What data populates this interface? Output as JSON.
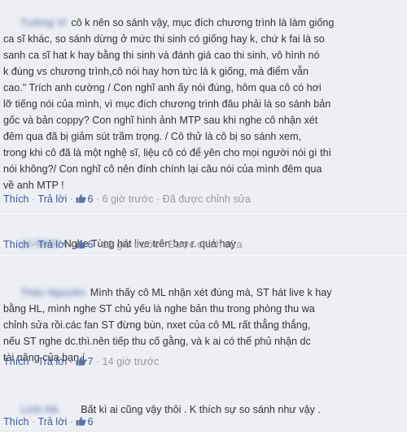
{
  "comments": [
    {
      "author": "Tường Vi",
      "text": "cô k nên so sánh vậy, mục đích chương trình là làm giống\nca sĩ khác, so sánh dừng ở mức thi sinh có giống hay k, chứ k fai là so\nsanh ca sĩ hat k hay bằng thi sinh và đánh giá cao thi sinh, vô hình nó\nk đúng vs chương trình,cô nói hay hơn tức là k giống, mà điểm vẫn\ncao.\" Trích anh cường / Con nghĩ anh ấy nói đúng, hôm qua cô có hơi\nlỡ tiếng nói của mình, vì mục đích chương trình đâu phải là so sánh bản\ngốc và bản coppy? Con nghĩ hình ảnh MTP sau khi nghe cô nhận xét\nđêm qua đã bị giảm sút trầm trọng. / Cô thử là cô bị so sánh xem,\ntrong khi cô đã là một nghệ sĩ, liệu cô có để yên cho mọi người nói gì thì\nnói không?/ Con nghĩ cô nên đính chính lại câu nói của mình đêm qua\nvề anh MTP !",
      "like_label": "Thích",
      "reply_label": "Trả lời",
      "likes": "6",
      "time": "6 giờ trước",
      "edited": "Đã được chỉnh sửa"
    },
    {
      "author": "Lê Minh",
      "text": "Nghe Tùng hát live trên bar r. quá hay",
      "like_label": "Thích",
      "reply_label": "Trả lời",
      "likes": "6",
      "time": "12 giờ trước",
      "edited": "Được chỉnh sửa"
    },
    {
      "author": "Thảo Nguyên",
      "text": "Mình thấy cô ML nhận xét đúng mà, ST hát live k hay\nbằng HL, mình nghe ST chủ yếu là nghe bản thu trong phòng thu wa\nchỉnh sửa rồi.các fan ST đừng bùn, nxet của cô ML rất thẳng thắng,\nnếu ST nghe dc.thì.nên tiếp thu cố gằng, và k ai có thể phủ nhận dc\ntài năng của bạn í.",
      "like_label": "Thích",
      "reply_label": "Trả lời",
      "likes": "7",
      "time": "14 giờ trước",
      "edited": ""
    },
    {
      "author": "Linh Hà",
      "text": "Bất kì ai cũng vậy thôi . K thích sự so sánh như vậy .",
      "like_label": "Thích",
      "reply_label": "Trả lời",
      "likes": "6",
      "time": "",
      "edited": ""
    }
  ],
  "colors": {
    "link": "#3b5998",
    "meta": "#999999",
    "bg": "#edeff4"
  },
  "icons": {
    "like": "thumbs-up-icon"
  }
}
